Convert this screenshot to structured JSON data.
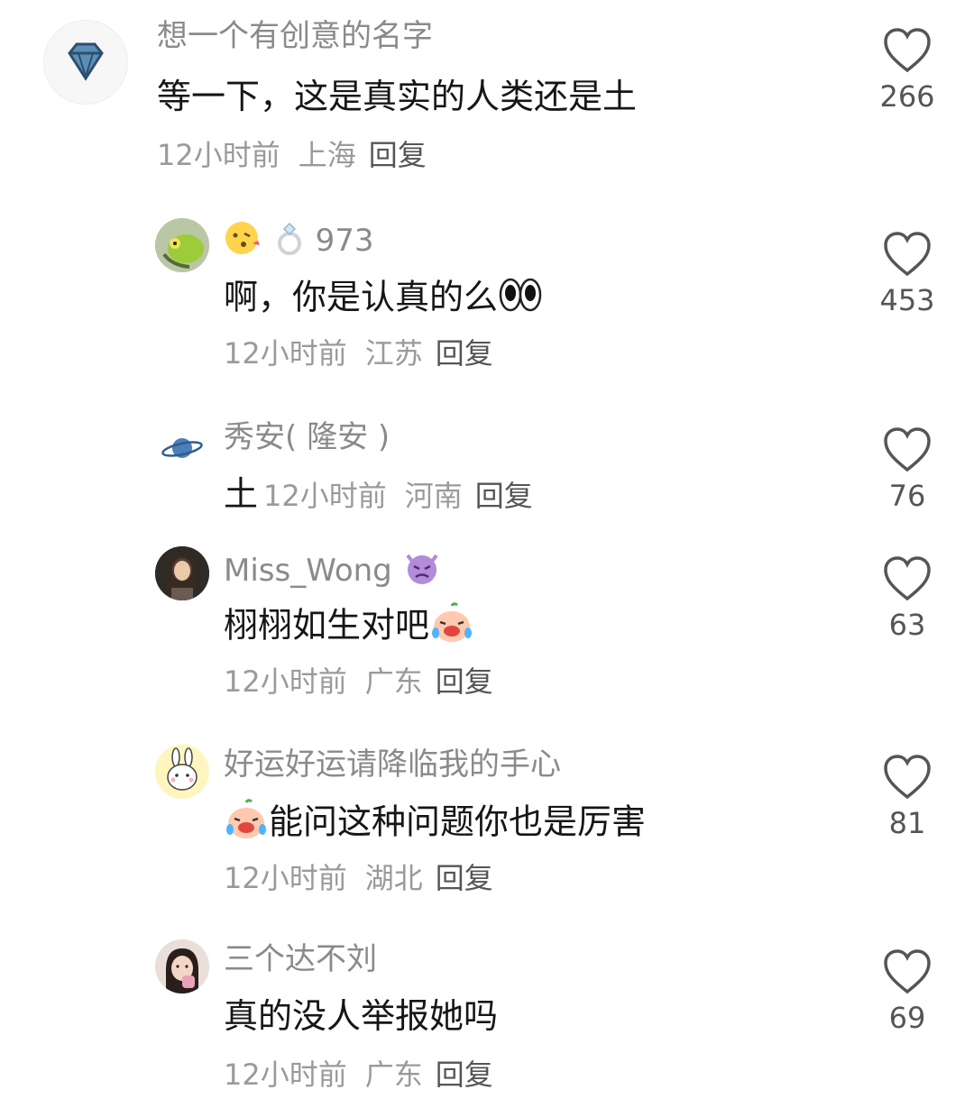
{
  "comments": [
    {
      "username": "想一个有创意的名字",
      "text": "等一下，这是真实的人类还是土",
      "time": "12小时前",
      "location": "上海",
      "reply_label": "回复",
      "likes": "266",
      "avatar_icon": "diamond-icon"
    },
    {
      "username": "973",
      "username_prefix_emoji": "kissing-face-emoji",
      "username_ring": "ring-emoji",
      "text": "啊，你是认真的么",
      "text_emoji": "eyes-emoji",
      "time": "12小时前",
      "location": "江苏",
      "reply_label": "回复",
      "likes": "453",
      "avatar_icon": "parrot-avatar"
    },
    {
      "username": "秀安( 隆安 )",
      "text": "土",
      "time": "12小时前",
      "location": "河南",
      "reply_label": "回复",
      "likes": "76",
      "avatar_icon": "planet-icon"
    },
    {
      "username": "Miss_Wong",
      "username_emoji": "angry-devil-emoji",
      "text": "栩栩如生对吧",
      "text_emoji": "crying-laughing-emoji",
      "time": "12小时前",
      "location": "广东",
      "reply_label": "回复",
      "likes": "63",
      "avatar_icon": "portrait-avatar"
    },
    {
      "username": "好运好运请降临我的手心",
      "text": "能问这种问题你也是厉害",
      "text_prefix_emoji": "crying-laughing-emoji",
      "time": "12小时前",
      "location": "湖北",
      "reply_label": "回复",
      "likes": "81",
      "avatar_icon": "bunny-avatar"
    },
    {
      "username": "三个达不刘",
      "text": "真的没人举报她吗",
      "time": "12小时前",
      "location": "广东",
      "reply_label": "回复",
      "likes": "69",
      "avatar_icon": "girl-avatar"
    }
  ],
  "colors": {
    "name": "#8a8a8a",
    "meta": "#9a9a9a",
    "text": "#161616",
    "icon": "#555555"
  }
}
